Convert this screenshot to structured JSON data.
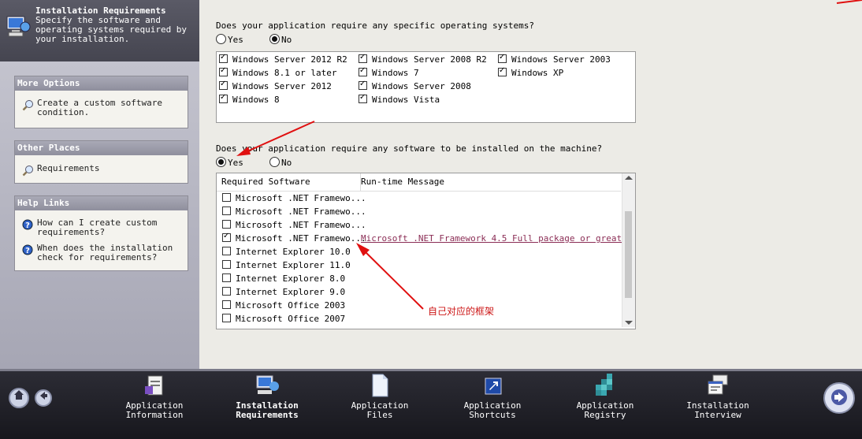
{
  "sidebar": {
    "header_title": "Installation Requirements",
    "header_subtitle": "Specify the software and operating systems required by your installation.",
    "more_options": {
      "title": "More Options",
      "items": [
        {
          "label": "Create a custom software condition.",
          "icon": "search-icon"
        }
      ]
    },
    "other_places": {
      "title": "Other Places",
      "items": [
        {
          "label": "Requirements",
          "icon": "search-icon"
        }
      ]
    },
    "help_links": {
      "title": "Help Links",
      "items": [
        {
          "label": "How can I create custom requirements?",
          "icon": "help-icon"
        },
        {
          "label": "When does the installation check for requirements?",
          "icon": "help-icon"
        }
      ]
    }
  },
  "os_question": {
    "text": "Does your application require any specific operating systems?",
    "yes_label": "Yes",
    "no_label": "No",
    "selected": "No",
    "items": [
      {
        "label": "Windows Server 2012 R2",
        "checked": true
      },
      {
        "label": "Windows Server 2008 R2",
        "checked": true
      },
      {
        "label": "Windows Server 2003",
        "checked": true
      },
      {
        "label": "Windows 8.1 or later",
        "checked": true
      },
      {
        "label": "Windows 7",
        "checked": true
      },
      {
        "label": "Windows XP",
        "checked": true
      },
      {
        "label": "Windows Server 2012",
        "checked": true
      },
      {
        "label": "Windows Server 2008",
        "checked": true
      },
      {
        "label": "Windows 8",
        "checked": true
      },
      {
        "label": "Windows Vista",
        "checked": true
      }
    ]
  },
  "software_question": {
    "text": "Does your application require any software to be installed on the machine?",
    "yes_label": "Yes",
    "no_label": "No",
    "selected": "Yes",
    "columns": [
      "Required Software",
      "Run-time Message"
    ],
    "rows": [
      {
        "name": "Microsoft .NET Framewo...",
        "checked": false,
        "message": ""
      },
      {
        "name": "Microsoft .NET Framewo...",
        "checked": false,
        "message": ""
      },
      {
        "name": "Microsoft .NET Framewo...",
        "checked": false,
        "message": ""
      },
      {
        "name": "Microsoft .NET Framewo...",
        "checked": true,
        "message": "Microsoft .NET Framework 4.5 Full package or great..."
      },
      {
        "name": "Internet Explorer 10.0",
        "checked": false,
        "message": ""
      },
      {
        "name": "Internet Explorer 11.0",
        "checked": false,
        "message": ""
      },
      {
        "name": "Internet Explorer 8.0",
        "checked": false,
        "message": ""
      },
      {
        "name": "Internet Explorer 9.0",
        "checked": false,
        "message": ""
      },
      {
        "name": "Microsoft Office 2003",
        "checked": false,
        "message": ""
      },
      {
        "name": "Microsoft Office 2007",
        "checked": false,
        "message": ""
      }
    ]
  },
  "annotation": {
    "text": "自己对应的框架",
    "color": "#cc1414"
  },
  "bottom_nav": {
    "steps": [
      {
        "label": "Application\nInformation",
        "icon": "app-info-icon",
        "active": false
      },
      {
        "label": "Installation\nRequirements",
        "icon": "computer-icon",
        "active": true
      },
      {
        "label": "Application\nFiles",
        "icon": "file-icon",
        "active": false
      },
      {
        "label": "Application\nShortcuts",
        "icon": "shortcut-icon",
        "active": false
      },
      {
        "label": "Application\nRegistry",
        "icon": "registry-icon",
        "active": false
      },
      {
        "label": "Installation\nInterview",
        "icon": "interview-icon",
        "active": false
      }
    ],
    "home_icon": "home-icon",
    "back_icon": "back-arrow-icon",
    "next_icon": "next-arrow-icon"
  }
}
